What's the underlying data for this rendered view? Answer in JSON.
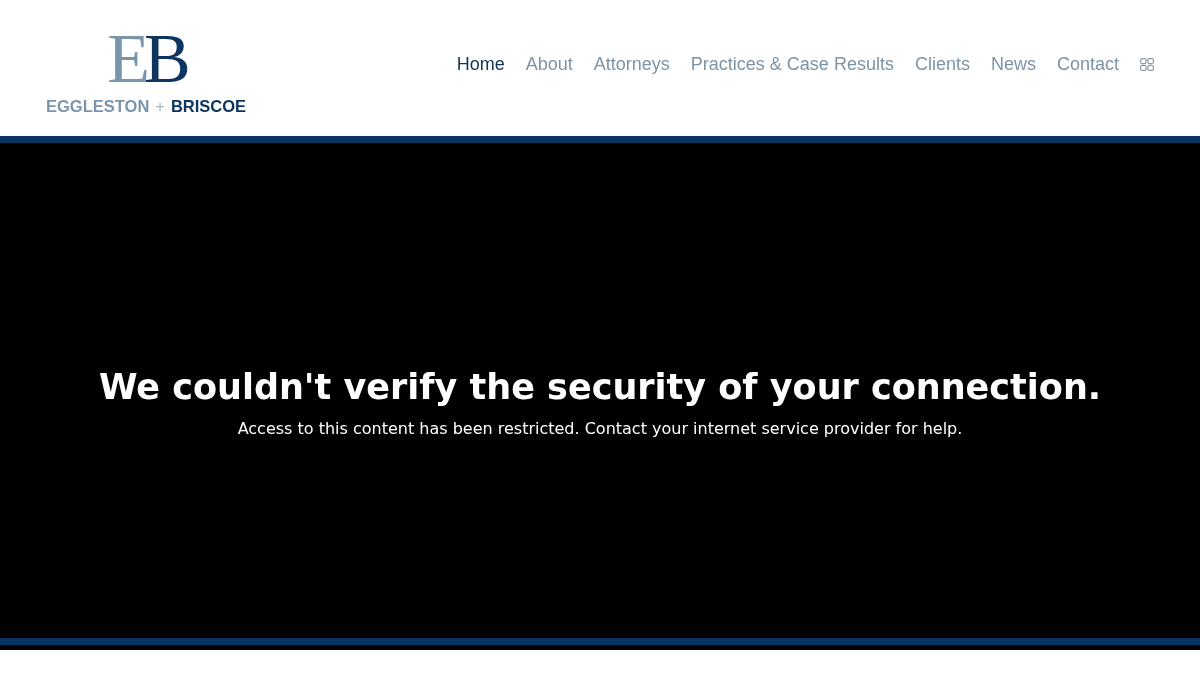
{
  "logo": {
    "monogram_left": "E",
    "monogram_right": "B",
    "name_left": "EGGLESTON",
    "separator": "+",
    "name_right": "BRISCOE"
  },
  "nav": [
    {
      "label": "Home",
      "selected": true
    },
    {
      "label": "About",
      "selected": false
    },
    {
      "label": "Attorneys",
      "selected": false
    },
    {
      "label": "Practices & Case Results",
      "selected": false
    },
    {
      "label": "Clients",
      "selected": false
    },
    {
      "label": "News",
      "selected": false
    },
    {
      "label": "Contact",
      "selected": false
    }
  ],
  "message": {
    "heading": "We couldn't verify the security of your connection.",
    "body": "Access to this content has been restricted. Contact your internet service provider for help."
  }
}
